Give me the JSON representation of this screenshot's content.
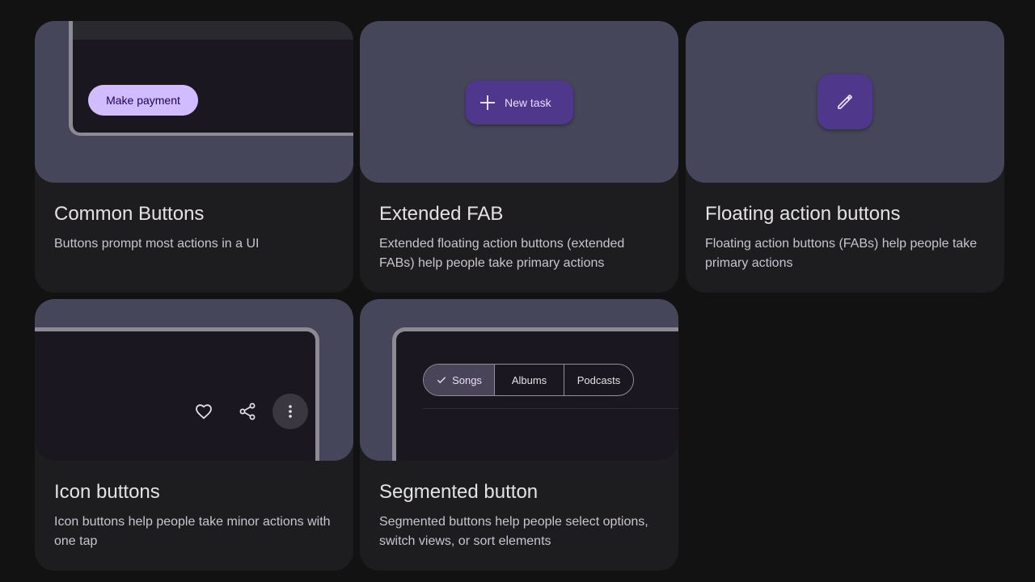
{
  "cards": [
    {
      "title": "Common Buttons",
      "description": "Buttons prompt most actions in a UI",
      "preview": {
        "button_label": "Make payment"
      }
    },
    {
      "title": "Extended FAB",
      "description": "Extended floating action buttons (extended FABs) help people take primary actions",
      "preview": {
        "button_label": "New task",
        "icon": "plus-icon"
      }
    },
    {
      "title": "Floating action buttons",
      "description": "Floating action buttons (FABs) help people take primary actions",
      "preview": {
        "icon": "pencil-icon"
      }
    },
    {
      "title": "Icon buttons",
      "description": "Icon buttons help people take minor actions with one tap",
      "preview": {
        "icons": [
          "heart-icon",
          "share-icon",
          "more-vert-icon"
        ]
      }
    },
    {
      "title": "Segmented button",
      "description": "Segmented buttons help people select options, switch views, or sort elements",
      "preview": {
        "segments": [
          "Songs",
          "Albums",
          "Podcasts"
        ],
        "selected": "Songs"
      }
    }
  ],
  "colors": {
    "background": "#121212",
    "card": "#1d1d20",
    "preview": "#46465a",
    "primary_container": "#d0bcff",
    "fab": "#4f378b"
  }
}
